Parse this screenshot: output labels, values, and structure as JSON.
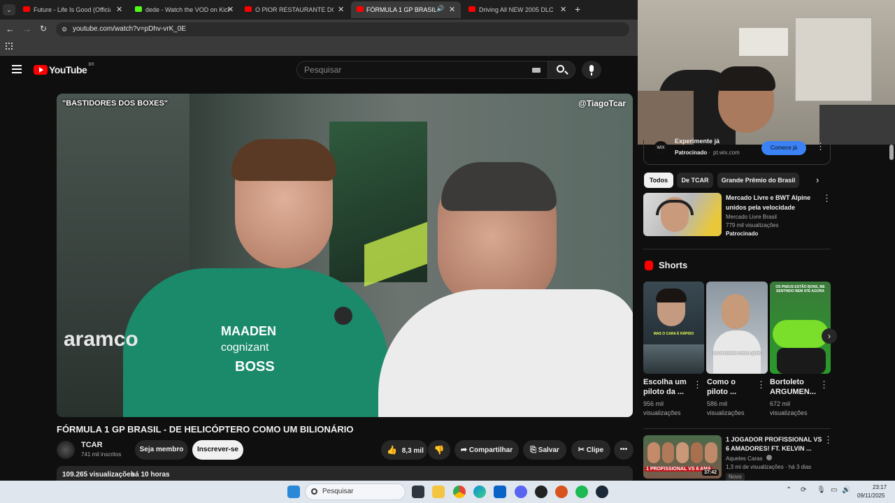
{
  "tabs": [
    {
      "label": "Future - Life Is Good (Official M",
      "active": false
    },
    {
      "label": "dede - Watch the VOD on Kick",
      "active": false
    },
    {
      "label": "O PIOR RESTAURANTE DO MU",
      "active": false
    },
    {
      "label": "FÓRMULA 1 GP BRASIL - D",
      "active": true
    },
    {
      "label": "Driving All NEW 2005 DLC Cars",
      "active": false
    }
  ],
  "address": {
    "url": "youtube.com/watch?v=pDhv-vrK_0E"
  },
  "youtube": {
    "logo": "YouTube",
    "region": "BR",
    "search_placeholder": "Pesquisar"
  },
  "video": {
    "overlay_left": "\"BASTIDORES DOS BOXES\"",
    "overlay_right": "@TiagoTcar",
    "title": "FÓRMULA 1 GP BRASIL - DE HELICÓPTERO COMO UM BILIONÁRIO",
    "views": "109.265 visualizações",
    "age": "há 10 horas"
  },
  "channel": {
    "name": "TCAR",
    "subs": "741 mil inscritos",
    "member_label": "Seja membro",
    "subscribe_label": "Inscrever-se"
  },
  "actions": {
    "likes": "8,3 mil",
    "share": "Compartilhar",
    "save": "Salvar",
    "clip": "Clipe"
  },
  "ad_top": {
    "brand": "WIX",
    "title": "Experimente já",
    "sponsor": "Patrocinado",
    "domain": "pt.wix.com",
    "cta": "Comece já"
  },
  "chips": [
    "Todos",
    "De TCAR",
    "Grande Prêmio do Brasil"
  ],
  "sponsored_video": {
    "title_line1": "Mercado Livre e BWT Alpine",
    "title_line2": "unidos pela velocidade",
    "channel": "Mercado Livre Brasil",
    "views": "779 mil visualizações",
    "badge": "Patrocinado"
  },
  "shorts": {
    "heading": "Shorts",
    "items": [
      {
        "title1": "Escolha um",
        "title2": "piloto da ...",
        "views1": "956 mil",
        "views2": "visualizações",
        "caption": "MAS O CARA É RÁPIDO"
      },
      {
        "title1": "Como o",
        "title2": "piloto ...",
        "views1": "586 mil",
        "views2": "visualizações",
        "caption": "vou te mostrar como a gente"
      },
      {
        "title1": "Bortoleto",
        "title2": "ARGUMEN...",
        "views1": "672 mil",
        "views2": "visualizações",
        "caption": "OS PNEUS ESTÃO BONS, ME SENTINDO BEM ATÉ AGORA"
      }
    ]
  },
  "next_video": {
    "title_line1": "1 JOGADOR PROFISSIONAL VS",
    "title_line2": "6 AMADORES! FT. KELVIN ...",
    "channel": "Aqueles Caras",
    "meta": "1,3 mi de visualizações · há 3 dias",
    "badge": "Novo",
    "duration": "37:42",
    "thumb_text": "1 PROFISSIONAL VS 6 AMA"
  },
  "taskbar": {
    "search_placeholder": "Pesquisar",
    "time": "23:17",
    "date": "09/11/2025"
  },
  "colors": {
    "youtube_red": "#ff0000",
    "bg": "#0f0f0f",
    "subscribe_bg": "#f1f1f1",
    "cta_blue": "#3b82f6"
  }
}
